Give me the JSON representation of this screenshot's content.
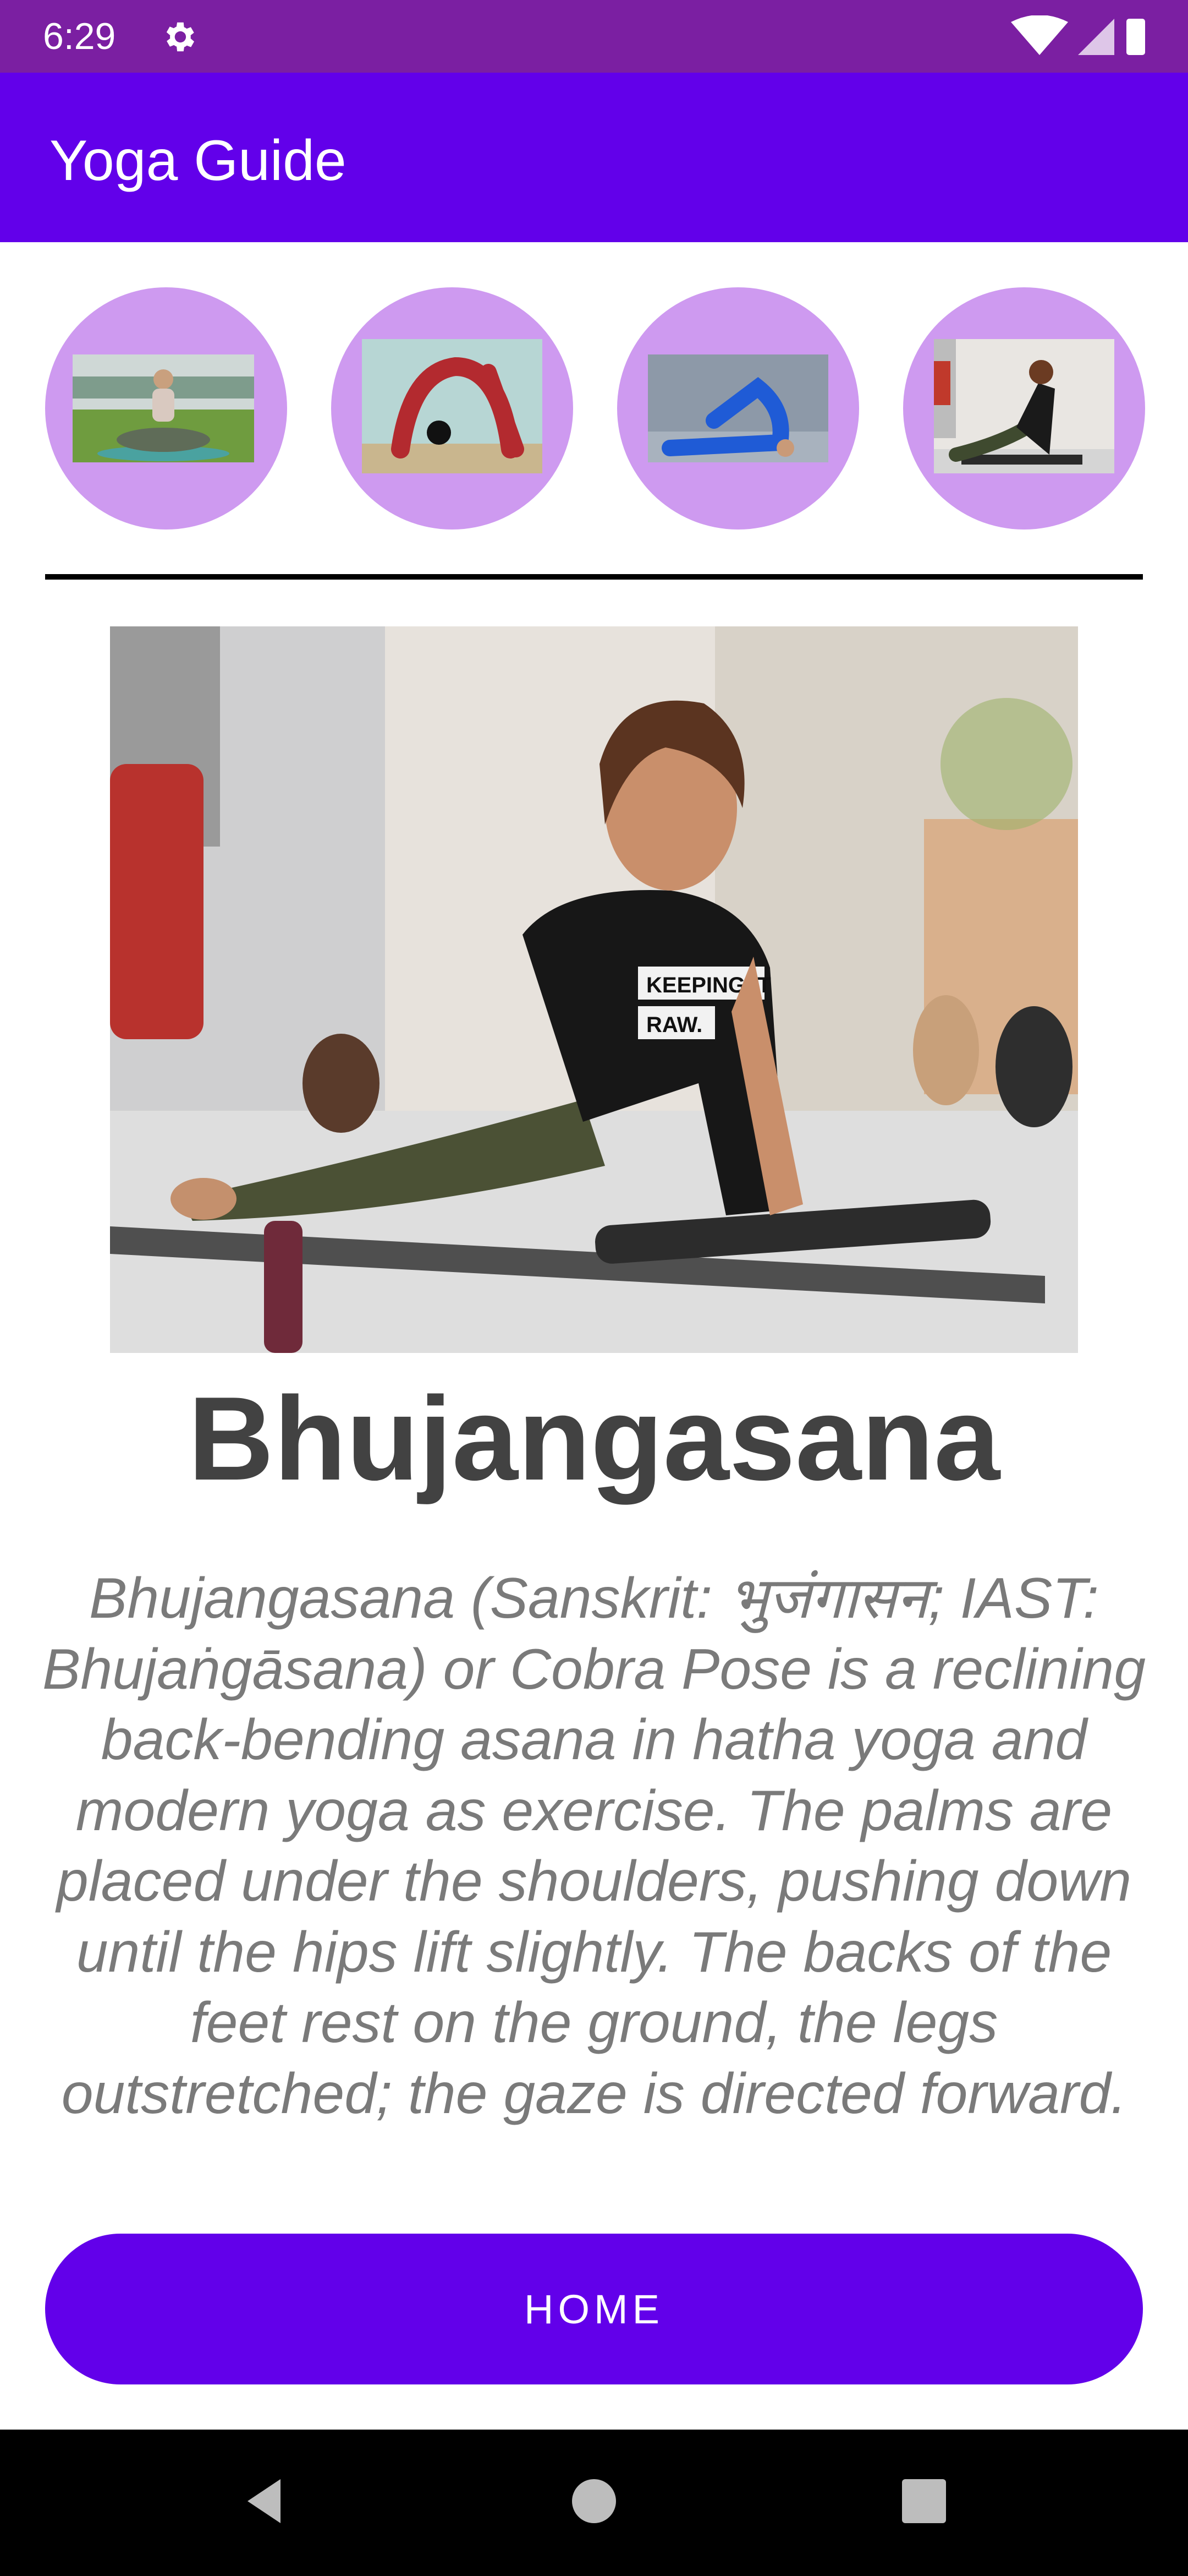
{
  "status_bar": {
    "time": "6:29",
    "icons": [
      "gear-icon",
      "wifi-icon",
      "signal-icon",
      "battery-icon"
    ]
  },
  "app_bar": {
    "title": "Yoga Guide",
    "color": "#6200ea"
  },
  "thumbnails": [
    {
      "name": "seated-meditation-pose"
    },
    {
      "name": "wheel-pose"
    },
    {
      "name": "plow-pose"
    },
    {
      "name": "cobra-pose"
    }
  ],
  "pose": {
    "title": "Bhujangasana",
    "description": "Bhujangasana (Sanskrit: भुजंगासन; IAST: Bhujaṅgāsana) or Cobra Pose is a reclining back-bending asana in hatha yoga and modern yoga as exercise. The palms are placed under the shoulders, pushing down until the hips lift slightly. The backs of the feet rest on the ground, the legs outstretched; the gaze is directed forward.",
    "hero_shirt_text": "KEEPING IT RAW."
  },
  "buttons": {
    "home_label": "HOME"
  },
  "nav": {
    "icons": [
      "back-icon",
      "home-circle-icon",
      "recents-icon"
    ]
  }
}
